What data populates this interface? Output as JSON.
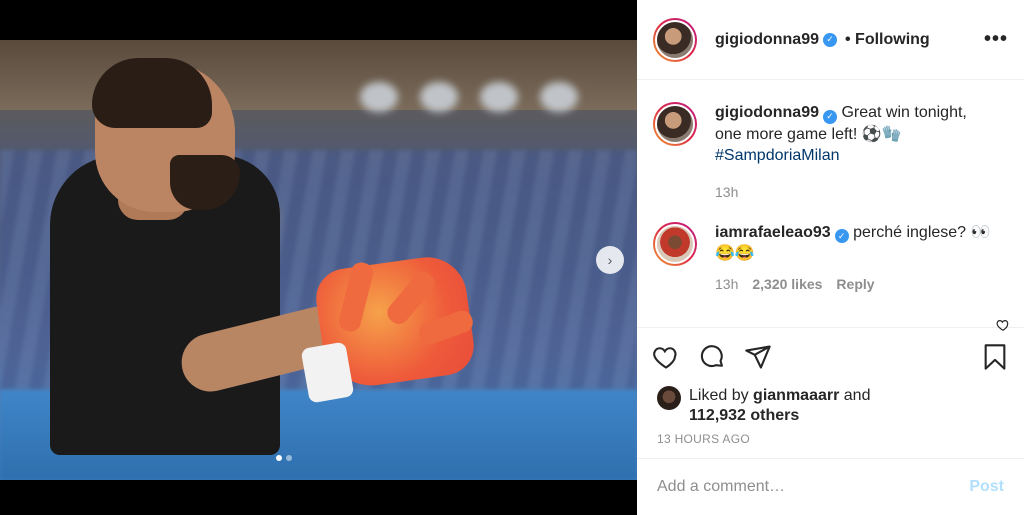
{
  "post": {
    "username": "gigiodonna99",
    "following_label": "• Following",
    "more_label": "•••",
    "carousel_next": "›",
    "carousel_count": 2,
    "carousel_active_index": 0
  },
  "caption": {
    "username": "gigiodonna99",
    "text": "Great win tonight, one more game left! ⚽🧤",
    "hashtag": "#SampdoriaMilan",
    "time": "13h"
  },
  "reply": {
    "username": "iamrafaeleao93",
    "text": "perché inglese? 👀😂😂",
    "time": "13h",
    "likes": "2,320 likes",
    "reply_label": "Reply"
  },
  "likes": {
    "prefix": "Liked by",
    "user": "gianmaaarr",
    "middle": "and",
    "others": "112,932 others"
  },
  "timestamp": "13 HOURS AGO",
  "comment_box": {
    "placeholder": "Add a comment…",
    "post_label": "Post"
  },
  "colors": {
    "verified": "#3897f0",
    "hashtag": "#00376b",
    "post_button": "#b2dffc",
    "muted": "#8e8e8e"
  },
  "icons": [
    "more-icon",
    "verified-icon",
    "chevron-right-icon",
    "heart-icon",
    "comment-icon",
    "share-icon",
    "bookmark-icon"
  ]
}
